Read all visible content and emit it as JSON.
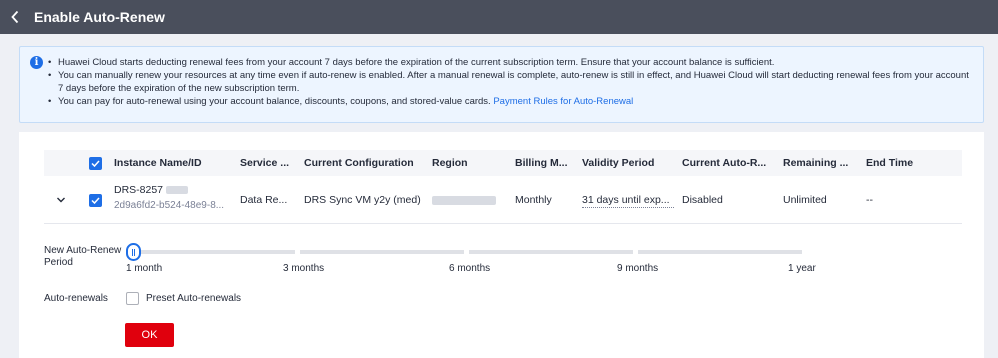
{
  "header": {
    "title": "Enable Auto-Renew"
  },
  "notice": {
    "items": [
      "Huawei Cloud starts deducting renewal fees from your account 7 days before the expiration of the current subscription term. Ensure that your account balance is sufficient.",
      "You can manually renew your resources at any time even if auto-renew is enabled. After a manual renewal is complete, auto-renew is still in effect, and Huawei Cloud will start deducting renewal fees from your account 7 days before the expiration of the new subscription term.",
      "You can pay for auto-renewal using your account balance, discounts, coupons, and stored-value cards."
    ],
    "link": "Payment Rules for Auto-Renewal"
  },
  "table": {
    "columns": [
      "Instance Name/ID",
      "Service ...",
      "Current Configuration",
      "Region",
      "Billing M...",
      "Validity Period",
      "Current Auto-R...",
      "Remaining ...",
      "End Time"
    ],
    "row": {
      "name": "DRS-8257",
      "id": "2d9a6fd2-b524-48e9-8...",
      "service": "Data Re...",
      "configuration": "DRS Sync VM y2y (med)",
      "region": "",
      "billing": "Monthly",
      "validity": "31 days until exp...",
      "auto_renew": "Disabled",
      "remaining": "Unlimited",
      "end_time": "--"
    }
  },
  "period": {
    "label": "New Auto-Renew Period",
    "ticks": [
      "1 month",
      "3 months",
      "6 months",
      "9 months",
      "1 year"
    ],
    "selected": "1 month"
  },
  "auto_renewals": {
    "label": "Auto-renewals",
    "option": "Preset Auto-renewals",
    "checked": false
  },
  "ok_label": "OK",
  "colors": {
    "accent": "#1e6ee6",
    "danger": "#e0000d",
    "header": "#4a4f5c"
  }
}
